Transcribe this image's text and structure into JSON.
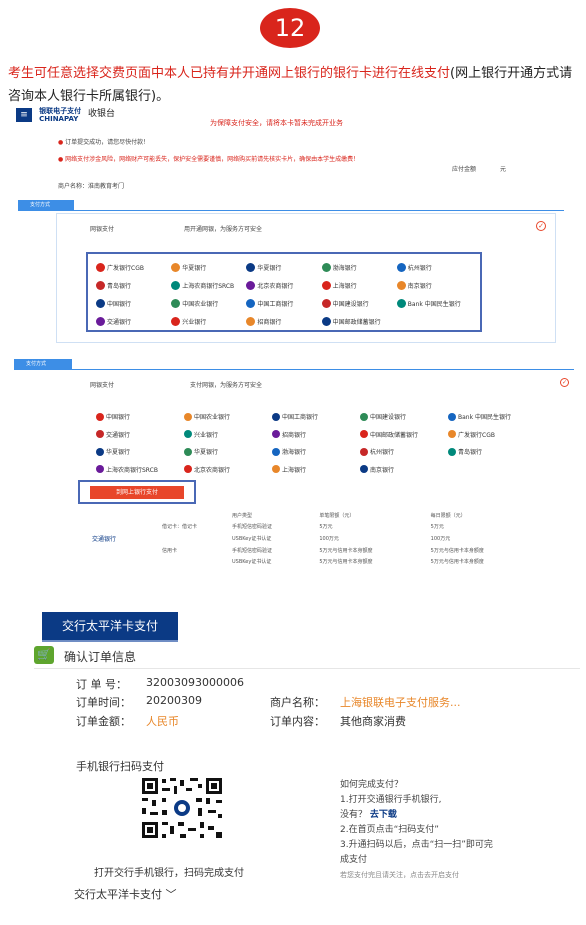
{
  "step": {
    "number": "12"
  },
  "intro": {
    "red_text": "考生可任意选择交费页面中本人已持有并开通网上银行的银行卡进行在线支付",
    "black_text": "(网上银行开通方式请咨询本人银行卡所属银行)。"
  },
  "cashier": {
    "logo_text": "银联电子支付",
    "logo_sub": "CHINAPAY",
    "title": "收银台",
    "safety_notice": "为保障支付安全，请将本卡暂未完成开业务",
    "order_submitted": "订单提交成功，请您尽快付款！",
    "warning": "网络支付涉金风险，网络财产可能丢失，保护安全需要谨慎，网络购买前请先核实卡片，确保由本学生成缴费！",
    "amount_label": "应付金额",
    "amount_unit": "元",
    "merchant": "商户名称：淮南教育考门",
    "section_pay_method": "支付方式",
    "netbank_label": "网银支付",
    "netbank_hint": "用开通网银，为服务方可安全",
    "banks_1": [
      "广发银行CGB",
      "华夏银行",
      "华夏银行",
      "渤海银行",
      "杭州银行",
      "青岛银行",
      "上海农商银行SRCB",
      "北京农商银行",
      "上海银行",
      "南京银行",
      "中国银行",
      "中国农业银行",
      "中国工商银行",
      "中国建设银行",
      "Bank 中国民生银行",
      "交通银行",
      "兴业银行",
      "招商银行",
      "中国邮政储蓄银行"
    ],
    "section_pay_method_2": "支付方式",
    "netbank_label_2": "网银支付",
    "netbank_hint_2": "支付网银，为服务方可安全",
    "banks_2": [
      "中国银行",
      "中国农业银行",
      "中国工商银行",
      "中国建设银行",
      "Bank 中国民生银行",
      "交通银行",
      "兴业银行",
      "招商银行",
      "中国邮政储蓄银行",
      "广发银行CGB",
      "华夏银行",
      "华夏银行",
      "渤海银行",
      "杭州银行",
      "青岛银行",
      "上海农商银行SRCB",
      "北京农商银行",
      "上海银行",
      "南京银行"
    ],
    "go_button": "到网上银行支付",
    "limits": {
      "headers": [
        "用户类型",
        "单笔限额（元）",
        "每日限额（元）"
      ],
      "rows": [
        [
          "手机短信密码验证",
          "5万元",
          "5万元"
        ],
        [
          "USBKey证书认证",
          "100万元",
          "100万元"
        ],
        [
          "手机短信密码验证",
          "5万元与信用卡本身额度",
          "5万元与信用卡本身额度"
        ],
        [
          "USBKey证书认证",
          "5万元与信用卡本身额度",
          "5万元与信用卡本身额度"
        ]
      ],
      "row_groups": [
        "借记卡：借记卡",
        "信用卡"
      ]
    },
    "bocom_side": "交通银行"
  },
  "bocom": {
    "title": "交行太平洋卡支付",
    "confirm_heading": "确认订单信息",
    "order_no_label": "订 单 号：",
    "order_no": "32003093000006",
    "order_time_label": "订单时间：",
    "order_time": "20200309",
    "merchant_label": "商户名称：",
    "merchant": "上海银联电子支付服务...",
    "order_amount_label": "订单金额：",
    "order_amount": "人民币",
    "order_content_label": "订单内容：",
    "order_content": "其他商家消费",
    "qr_heading": "手机银行扫码支付",
    "qr_caption": "打开交行手机银行，扫码完成支付",
    "howto_title": "如何完成支付？",
    "howto_1": "1.打开交通银行手机银行,",
    "howto_2a": "没有？",
    "howto_2b": "去下载",
    "howto_3": "2.在首页点击“扫码支付”",
    "howto_4": "3.升通扫码以后，点击“扫一扫”即可完",
    "howto_5": "成支付",
    "howto_6": "若您支付完且请关注，点击去开启支付",
    "bottom_link": "交行太平洋卡支付 ﹀"
  },
  "colors": {
    "accent": "#d9251c",
    "bocom_blue": "#0b3a85",
    "tag_blue": "#3d8ee6",
    "orange": "#e8872a"
  }
}
